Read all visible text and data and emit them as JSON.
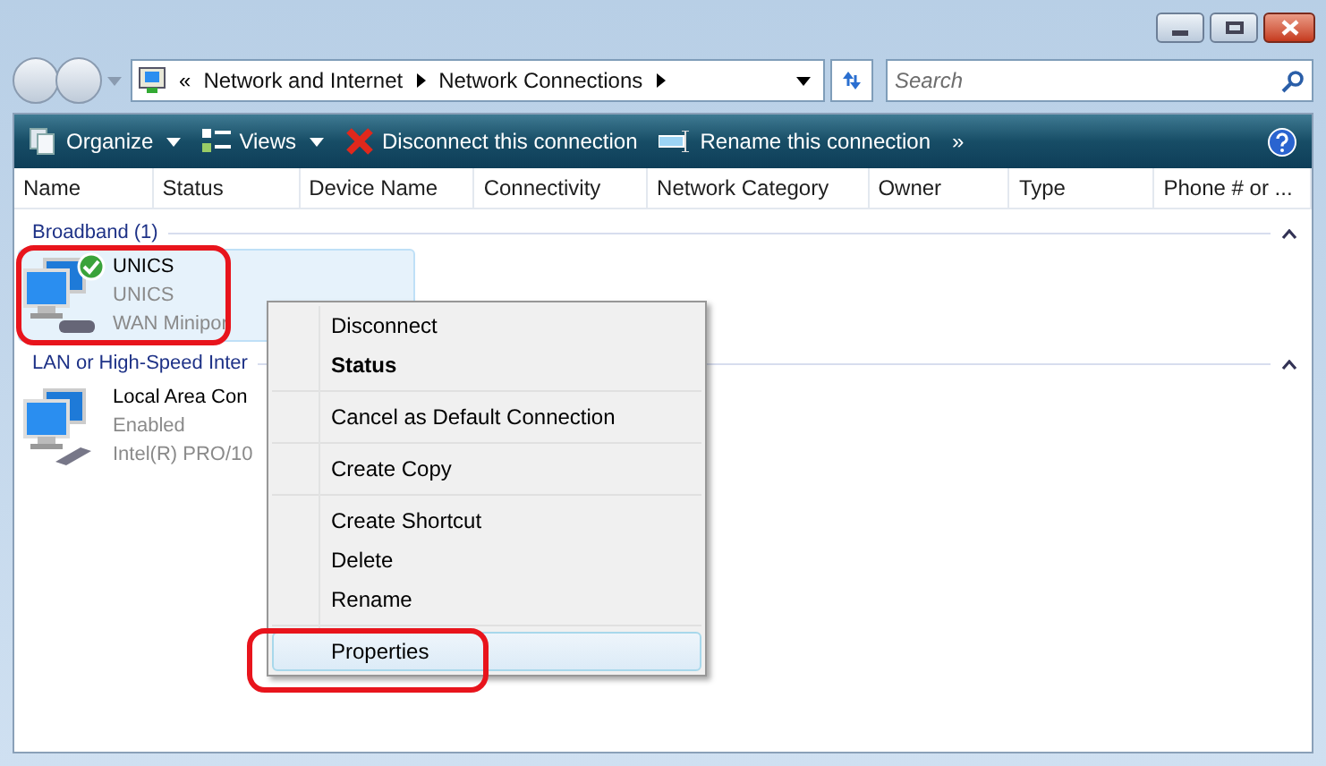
{
  "address": {
    "overflow": "«",
    "crumbs": [
      "Network and Internet",
      "Network Connections"
    ]
  },
  "search": {
    "placeholder": "Search"
  },
  "toolbar": [
    {
      "kind": "organize",
      "label": "Organize",
      "dropdown": true
    },
    {
      "kind": "views",
      "label": "Views",
      "dropdown": true
    },
    {
      "kind": "disconnect",
      "label": "Disconnect this connection",
      "dropdown": false
    },
    {
      "kind": "rename",
      "label": "Rename this connection",
      "dropdown": false
    },
    {
      "kind": "more",
      "label": "»",
      "dropdown": false
    }
  ],
  "columns": [
    "Name",
    "Status",
    "Device Name",
    "Connectivity",
    "Network Category",
    "Owner",
    "Type",
    "Phone # or ..."
  ],
  "groups": [
    {
      "title": "Broadband (1)",
      "items": [
        {
          "kind": "dialup",
          "name": "UNICS",
          "status": "UNICS",
          "device": "WAN Minipor",
          "selected": true,
          "connected": true
        }
      ]
    },
    {
      "title": "LAN or High-Speed Inter",
      "items": [
        {
          "kind": "lan",
          "name": "Local Area Con",
          "status": "Enabled",
          "device": "Intel(R) PRO/10",
          "selected": false,
          "connected": false
        }
      ]
    }
  ],
  "context_menu": [
    [
      {
        "label": "Disconnect",
        "bold": false,
        "selected": false
      },
      {
        "label": "Status",
        "bold": true,
        "selected": false
      }
    ],
    [
      {
        "label": "Cancel as Default Connection",
        "bold": false,
        "selected": false
      }
    ],
    [
      {
        "label": "Create Copy",
        "bold": false,
        "selected": false
      }
    ],
    [
      {
        "label": "Create Shortcut",
        "bold": false,
        "selected": false
      },
      {
        "label": "Delete",
        "bold": false,
        "selected": false
      },
      {
        "label": "Rename",
        "bold": false,
        "selected": false
      }
    ],
    [
      {
        "label": "Properties",
        "bold": false,
        "selected": true
      }
    ]
  ]
}
